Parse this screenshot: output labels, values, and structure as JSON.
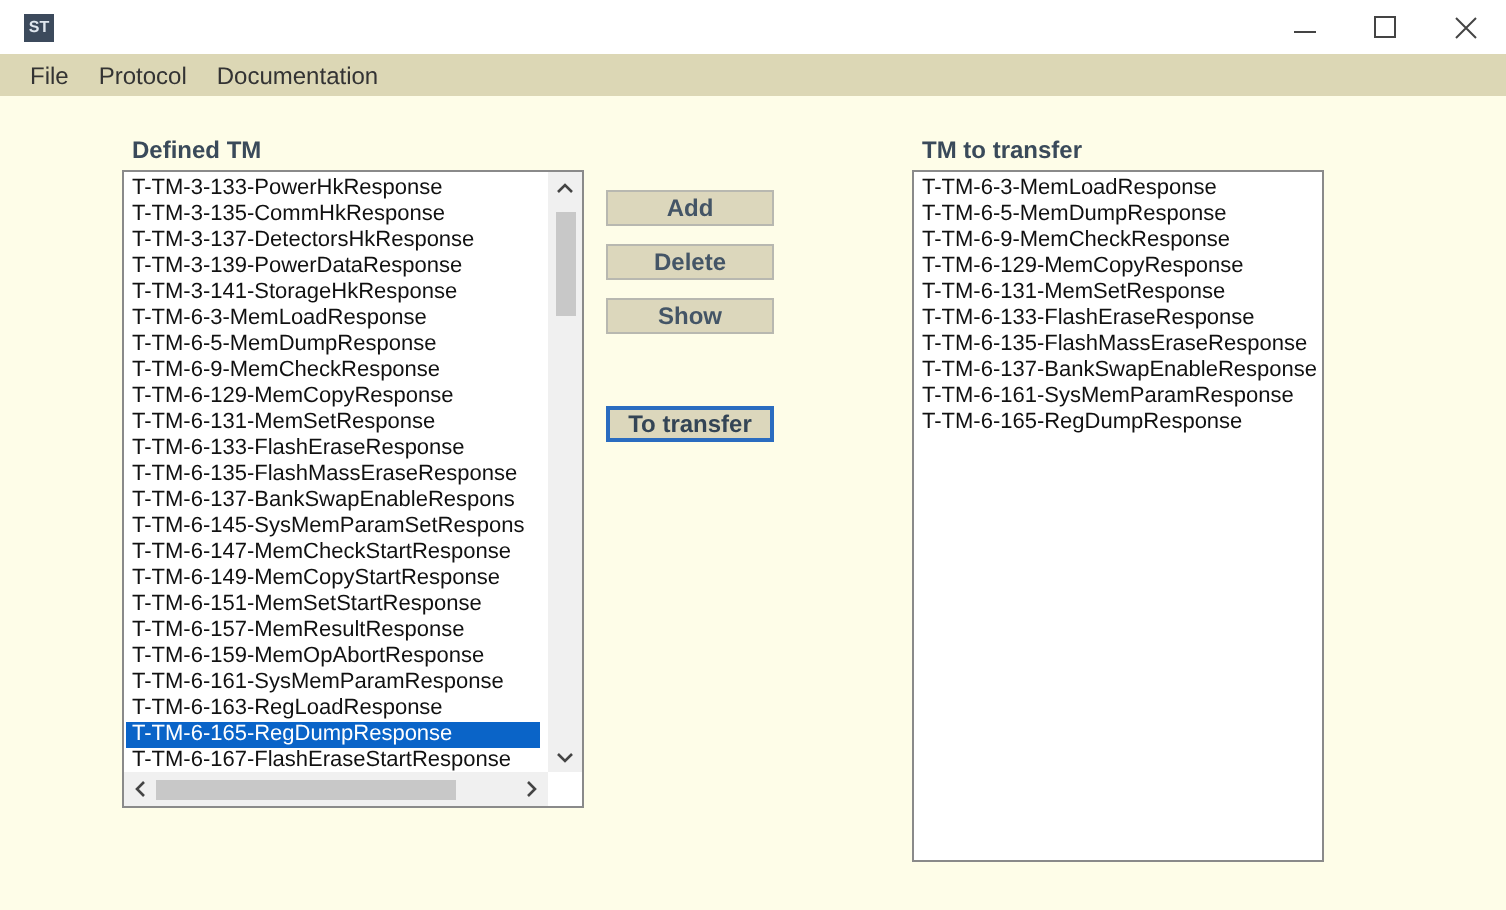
{
  "window": {
    "app_badge": "ST"
  },
  "menu": [
    "File",
    "Protocol",
    "Documentation"
  ],
  "defined_tm": {
    "label": "Defined TM",
    "items": [
      {
        "text": "T-TM-3-133-PowerHkResponse",
        "selected": false
      },
      {
        "text": "T-TM-3-135-CommHkResponse",
        "selected": false
      },
      {
        "text": "T-TM-3-137-DetectorsHkResponse",
        "selected": false
      },
      {
        "text": "T-TM-3-139-PowerDataResponse",
        "selected": false
      },
      {
        "text": "T-TM-3-141-StorageHkResponse",
        "selected": false
      },
      {
        "text": "T-TM-6-3-MemLoadResponse",
        "selected": false
      },
      {
        "text": "T-TM-6-5-MemDumpResponse",
        "selected": false
      },
      {
        "text": "T-TM-6-9-MemCheckResponse",
        "selected": false
      },
      {
        "text": "T-TM-6-129-MemCopyResponse",
        "selected": false
      },
      {
        "text": "T-TM-6-131-MemSetResponse",
        "selected": false
      },
      {
        "text": "T-TM-6-133-FlashEraseResponse",
        "selected": false
      },
      {
        "text": "T-TM-6-135-FlashMassEraseResponse",
        "selected": false
      },
      {
        "text": "T-TM-6-137-BankSwapEnableRespons",
        "selected": false
      },
      {
        "text": "T-TM-6-145-SysMemParamSetRespons",
        "selected": false
      },
      {
        "text": "T-TM-6-147-MemCheckStartResponse",
        "selected": false
      },
      {
        "text": "T-TM-6-149-MemCopyStartResponse",
        "selected": false
      },
      {
        "text": "T-TM-6-151-MemSetStartResponse",
        "selected": false
      },
      {
        "text": "T-TM-6-157-MemResultResponse",
        "selected": false
      },
      {
        "text": "T-TM-6-159-MemOpAbortResponse",
        "selected": false
      },
      {
        "text": "T-TM-6-161-SysMemParamResponse",
        "selected": false
      },
      {
        "text": "T-TM-6-163-RegLoadResponse",
        "selected": false
      },
      {
        "text": "T-TM-6-165-RegDumpResponse",
        "selected": true
      },
      {
        "text": "T-TM-6-167-FlashEraseStartResponse",
        "selected": false
      }
    ]
  },
  "buttons": [
    {
      "label": "Add",
      "focused": false
    },
    {
      "label": "Delete",
      "focused": false
    },
    {
      "label": "Show",
      "focused": false
    },
    {
      "label": "To transfer",
      "focused": true
    }
  ],
  "tm_to_transfer": {
    "label": "TM to transfer",
    "items": [
      {
        "text": "T-TM-6-3-MemLoadResponse",
        "selected": false
      },
      {
        "text": "T-TM-6-5-MemDumpResponse",
        "selected": false
      },
      {
        "text": "T-TM-6-9-MemCheckResponse",
        "selected": false
      },
      {
        "text": "T-TM-6-129-MemCopyResponse",
        "selected": false
      },
      {
        "text": "T-TM-6-131-MemSetResponse",
        "selected": false
      },
      {
        "text": "T-TM-6-133-FlashEraseResponse",
        "selected": false
      },
      {
        "text": "T-TM-6-135-FlashMassEraseResponse",
        "selected": false
      },
      {
        "text": "T-TM-6-137-BankSwapEnableResponse",
        "selected": false
      },
      {
        "text": "T-TM-6-161-SysMemParamResponse",
        "selected": false
      },
      {
        "text": "T-TM-6-165-RegDumpResponse",
        "selected": false
      }
    ]
  }
}
